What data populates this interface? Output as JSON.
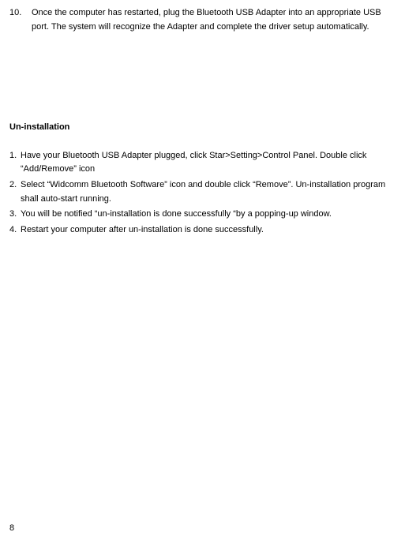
{
  "install": {
    "step_number": "10.",
    "step_text": "Once the computer has restarted, plug the Bluetooth USB Adapter into an appropriate USB port. The system will recognize the Adapter and complete the driver setup automatically."
  },
  "uninstall": {
    "heading": "Un-installation",
    "items": [
      {
        "number": "1.",
        "text": "Have your Bluetooth USB Adapter plugged, click Star>Setting>Control Panel. Double click “Add/Remove” icon"
      },
      {
        "number": "2.",
        "text": "Select “Widcomm Bluetooth Software” icon and double click “Remove”. Un-installation program shall auto-start running."
      },
      {
        "number": "3.",
        "text": "You will be notified “un-installation is done successfully “by a popping-up window."
      },
      {
        "number": "4.",
        "text": "Restart your computer after un-installation is done successfully."
      }
    ]
  },
  "page_number": "8"
}
